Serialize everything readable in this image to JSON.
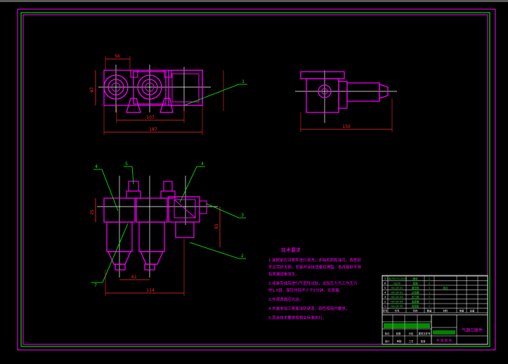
{
  "colors": {
    "background": "#000000",
    "outer_frame": "#ff00ff",
    "inner_frame": "#00ff00",
    "part_outline": "#ff00ff",
    "dimension": "#ff2a2a",
    "centerline": "#ffffff",
    "leader": "#00ff00",
    "notes_text": "#ff00ff",
    "title_block": "#ffffff",
    "white_dim": "#ffffff"
  },
  "top_view": {
    "dim_top": "56",
    "dim_left": "φ3",
    "dim_mid": "107",
    "dim_overall": "187",
    "balloon": "1"
  },
  "side_view": {
    "dim_overall": "150"
  },
  "front_view": {
    "balloon_a": "4",
    "balloon_b": "5",
    "balloon_c": "4",
    "balloon_d": "3",
    "balloon_e": "2",
    "balloon_f": "7",
    "dim_left_h": "25",
    "dim_right_h": "65",
    "dim_pitch": "61",
    "dim_overall": "114"
  },
  "notes": {
    "title": "技术要求",
    "lines": [
      "1.装配前应对零件进行清洗，去除毛刺和油污，各密封",
      "件应完好无损，安装时涂抹适量润滑脂，各连接处不得",
      "有泄漏现象发生。",
      "2.组装完成后进行气密性试验，试验压力为工作压力",
      "的1.5倍，保压时间不少于5分钟，无泄漏。",
      "3.外观表面应光洁。",
      "4.外露非加工表面涂防锈漆，颜色按用户要求。",
      "5.其余技术要求按相关标准执行。"
    ]
  },
  "title_block": {
    "part_rows": [
      [
        "7",
        "GB/T6170-2000",
        "螺母",
        "2",
        "",
        "",
        ""
      ],
      [
        "6",
        "Q235",
        "垫圈",
        "2",
        "",
        "",
        ""
      ],
      [
        "5",
        "HX-QF-01",
        "调压阀",
        "1",
        "组合",
        "",
        ""
      ],
      [
        "4",
        "HX-QF-02",
        "过滤器",
        "1",
        "",
        "",
        ""
      ],
      [
        "3",
        "HX-QF-03",
        "压力表",
        "1",
        "",
        "",
        ""
      ],
      [
        "2",
        "HX-QF-04",
        "油雾器",
        "1",
        "",
        "",
        ""
      ],
      [
        "1",
        "HX-QF-05",
        "连接板",
        "1",
        "",
        "",
        ""
      ]
    ],
    "header_labels": [
      "序号",
      "代号",
      "名称",
      "数量",
      "材料",
      "单重",
      "总重"
    ],
    "title": "气源三联件",
    "sign_labels": [
      "标记",
      "处数",
      "分区",
      "更改文件号",
      "签名",
      "年月日"
    ],
    "approve_labels": [
      "设计",
      "审核",
      "工艺",
      "批准"
    ],
    "scale_label": "共 张 第 张"
  }
}
